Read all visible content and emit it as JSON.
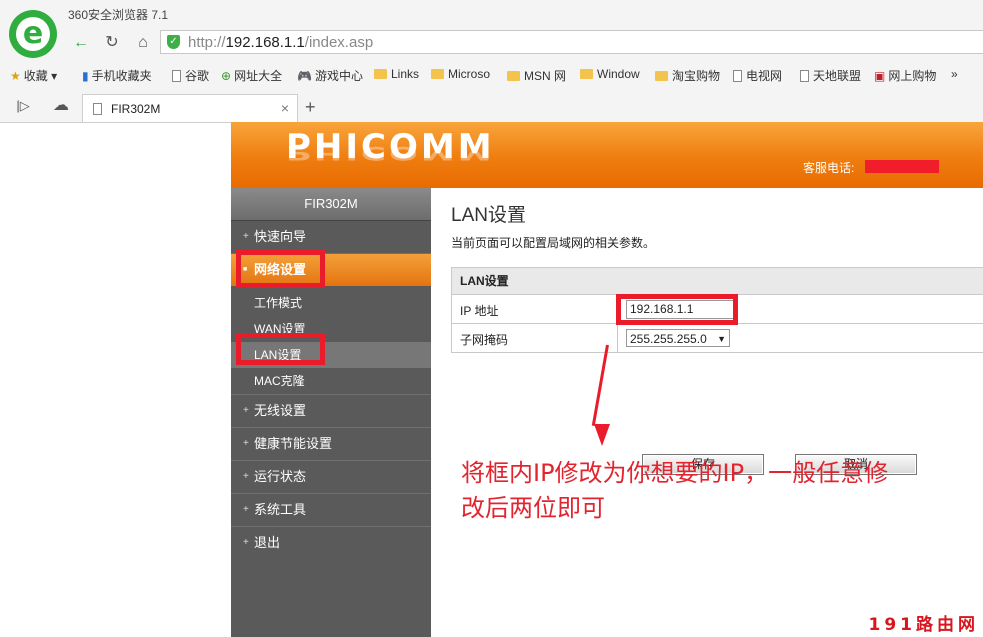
{
  "browser": {
    "title": "360安全浏览器 7.1",
    "url_prefix": "http://",
    "url_host": "192.168.1.1",
    "url_path": "/index.asp",
    "bookmarks": [
      "收藏",
      "手机收藏夹",
      "谷歌",
      "网址大全",
      "游戏中心",
      "Links",
      "Microso",
      "MSN 网",
      "Window",
      "淘宝购物",
      "电视网",
      "天地联盟",
      "网上购物",
      "»"
    ],
    "tab_title": "FIR302M",
    "new_tab": "+",
    "close_tab": "×"
  },
  "router": {
    "brand": "PHICOMM",
    "hotline_label": "客服电话:",
    "model": "FIR302M",
    "menu": {
      "quick_setup": "快速向导",
      "network": "网络设置",
      "work_mode": "工作模式",
      "wan": "WAN设置",
      "lan": "LAN设置",
      "mac_clone": "MAC克隆",
      "wireless": "无线设置",
      "energy": "健康节能设置",
      "status": "运行状态",
      "tools": "系统工具",
      "logout": "退出"
    },
    "page_title": "LAN设置",
    "page_desc": "当前页面可以配置局域网的相关参数。",
    "section_title": "LAN设置",
    "ip_label": "IP 地址",
    "ip_value": "192.168.1.1",
    "mask_label": "子网掩码",
    "mask_value": "255.255.255.0",
    "save_label": "保存",
    "cancel_label": "取消"
  },
  "annotation": "将框内IP修改为你想要的IP，一般任意修改后两位即可",
  "watermark": "191路由网",
  "colors": {
    "accent": "#ef7d0f",
    "highlight": "#ea1c2b",
    "sidebar": "#5a5a5a"
  }
}
